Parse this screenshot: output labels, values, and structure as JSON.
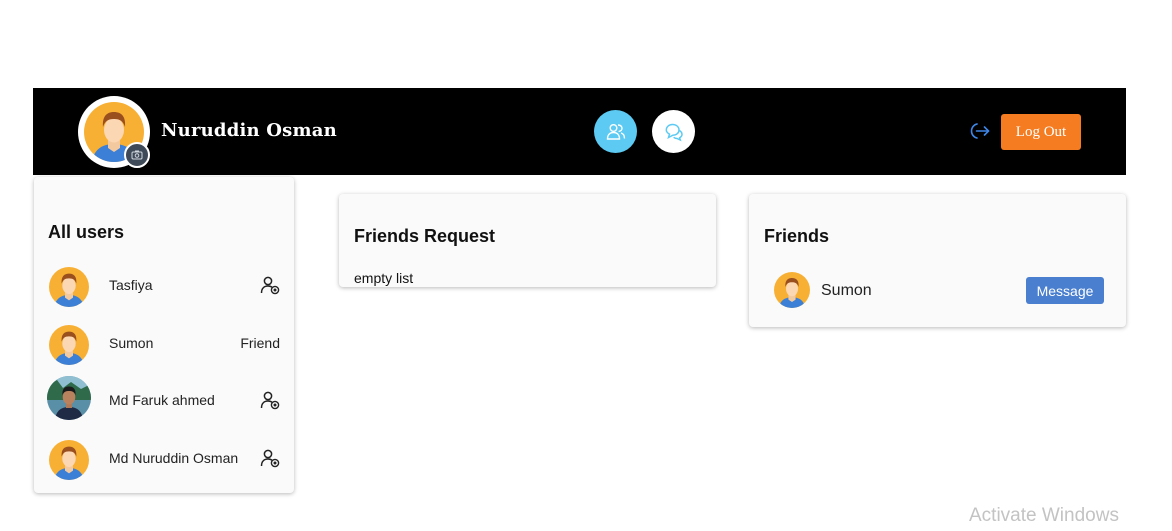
{
  "header": {
    "profile_name": "Nuruddin Osman",
    "avatar_icon": "default-avatar-icon",
    "camera_icon": "camera-icon",
    "nav": [
      {
        "icon": "users-icon",
        "color": "#5ccaf2"
      },
      {
        "icon": "chat-bubbles-icon",
        "color": "#ffffff"
      }
    ],
    "logout_icon": "logout-arrow-icon",
    "logout_label": "Log Out",
    "logout_color": "#f57c20",
    "background": "#000000"
  },
  "all_users": {
    "title": "All users",
    "users": [
      {
        "name": "Tasfiya",
        "avatar": "default-avatar-icon",
        "action": "add-friend-icon",
        "status": ""
      },
      {
        "name": "Sumon",
        "avatar": "default-avatar-icon",
        "action": "",
        "status": "Friend"
      },
      {
        "name": "Md Faruk ahmed",
        "avatar": "photo-avatar",
        "action": "add-friend-icon",
        "status": ""
      },
      {
        "name": "Md Nuruddin Osman",
        "avatar": "default-avatar-icon",
        "action": "add-friend-icon",
        "status": ""
      }
    ]
  },
  "friend_requests": {
    "title": "Friends Request",
    "empty_text": "empty list"
  },
  "friends": {
    "title": "Friends",
    "items": [
      {
        "name": "Sumon",
        "avatar": "default-avatar-icon",
        "button_label": "Message",
        "button_color": "#4a7fd0"
      }
    ]
  },
  "watermark": "Activate Windows"
}
